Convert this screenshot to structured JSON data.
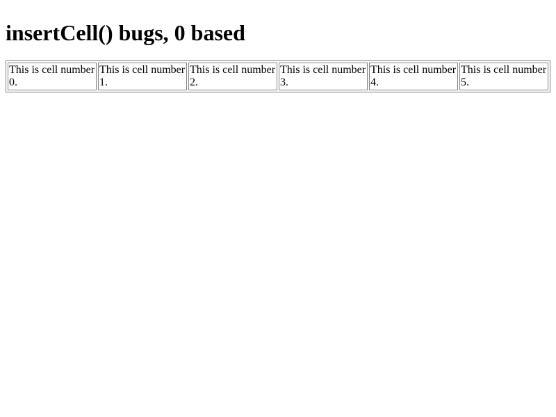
{
  "page": {
    "heading": "insertCell() bugs, 0 based"
  },
  "table": {
    "cells": [
      "This is cell number 0.",
      "This is cell number 1.",
      "This is cell number 2.",
      "This is cell number 3.",
      "This is cell number 4.",
      "This is cell number 5."
    ]
  }
}
